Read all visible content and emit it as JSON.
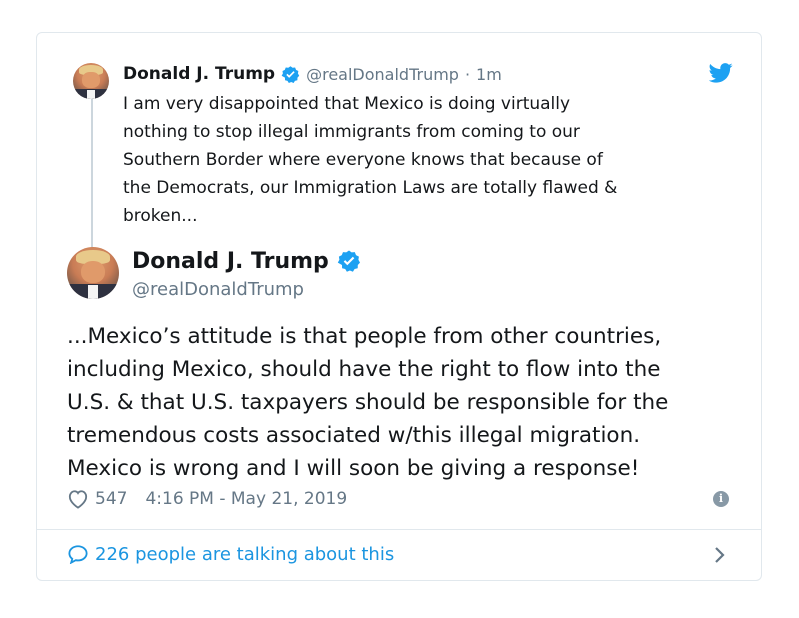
{
  "quoted_tweet": {
    "author_name": "Donald J. Trump",
    "handle": "@realDonaldTrump",
    "separator": "·",
    "time_ago": "1m",
    "text": "I am very disappointed that Mexico is doing virtually\nnothing to stop illegal immigrants from coming to our\nSouthern Border where everyone knows that because of\nthe Democrats, our Immigration Laws are totally flawed &\nbroken..."
  },
  "main_tweet": {
    "author_name": "Donald J. Trump",
    "handle": "@realDonaldTrump",
    "text": "...Mexico’s attitude is that people from other countries,\nincluding Mexico, should have the right to flow into the\nU.S. & that U.S. taxpayers should be responsible for the\ntremendous costs associated w/this illegal migration.\nMexico is wrong and I will soon be giving a response!",
    "likes": "547",
    "timestamp": "4:16 PM - May 21, 2019"
  },
  "footer": {
    "talking_label": "226 people are talking about this"
  },
  "icons": {
    "verified": "verified-badge-icon",
    "twitter": "twitter-bird-icon",
    "like": "heart-icon",
    "info": "info-icon",
    "reply": "speech-bubble-icon",
    "chevron": "chevron-right-icon"
  },
  "colors": {
    "twitter_blue": "#1da1f2",
    "link_blue": "#1b95e0",
    "muted_gray": "#657786",
    "border": "#e1e8ed"
  }
}
